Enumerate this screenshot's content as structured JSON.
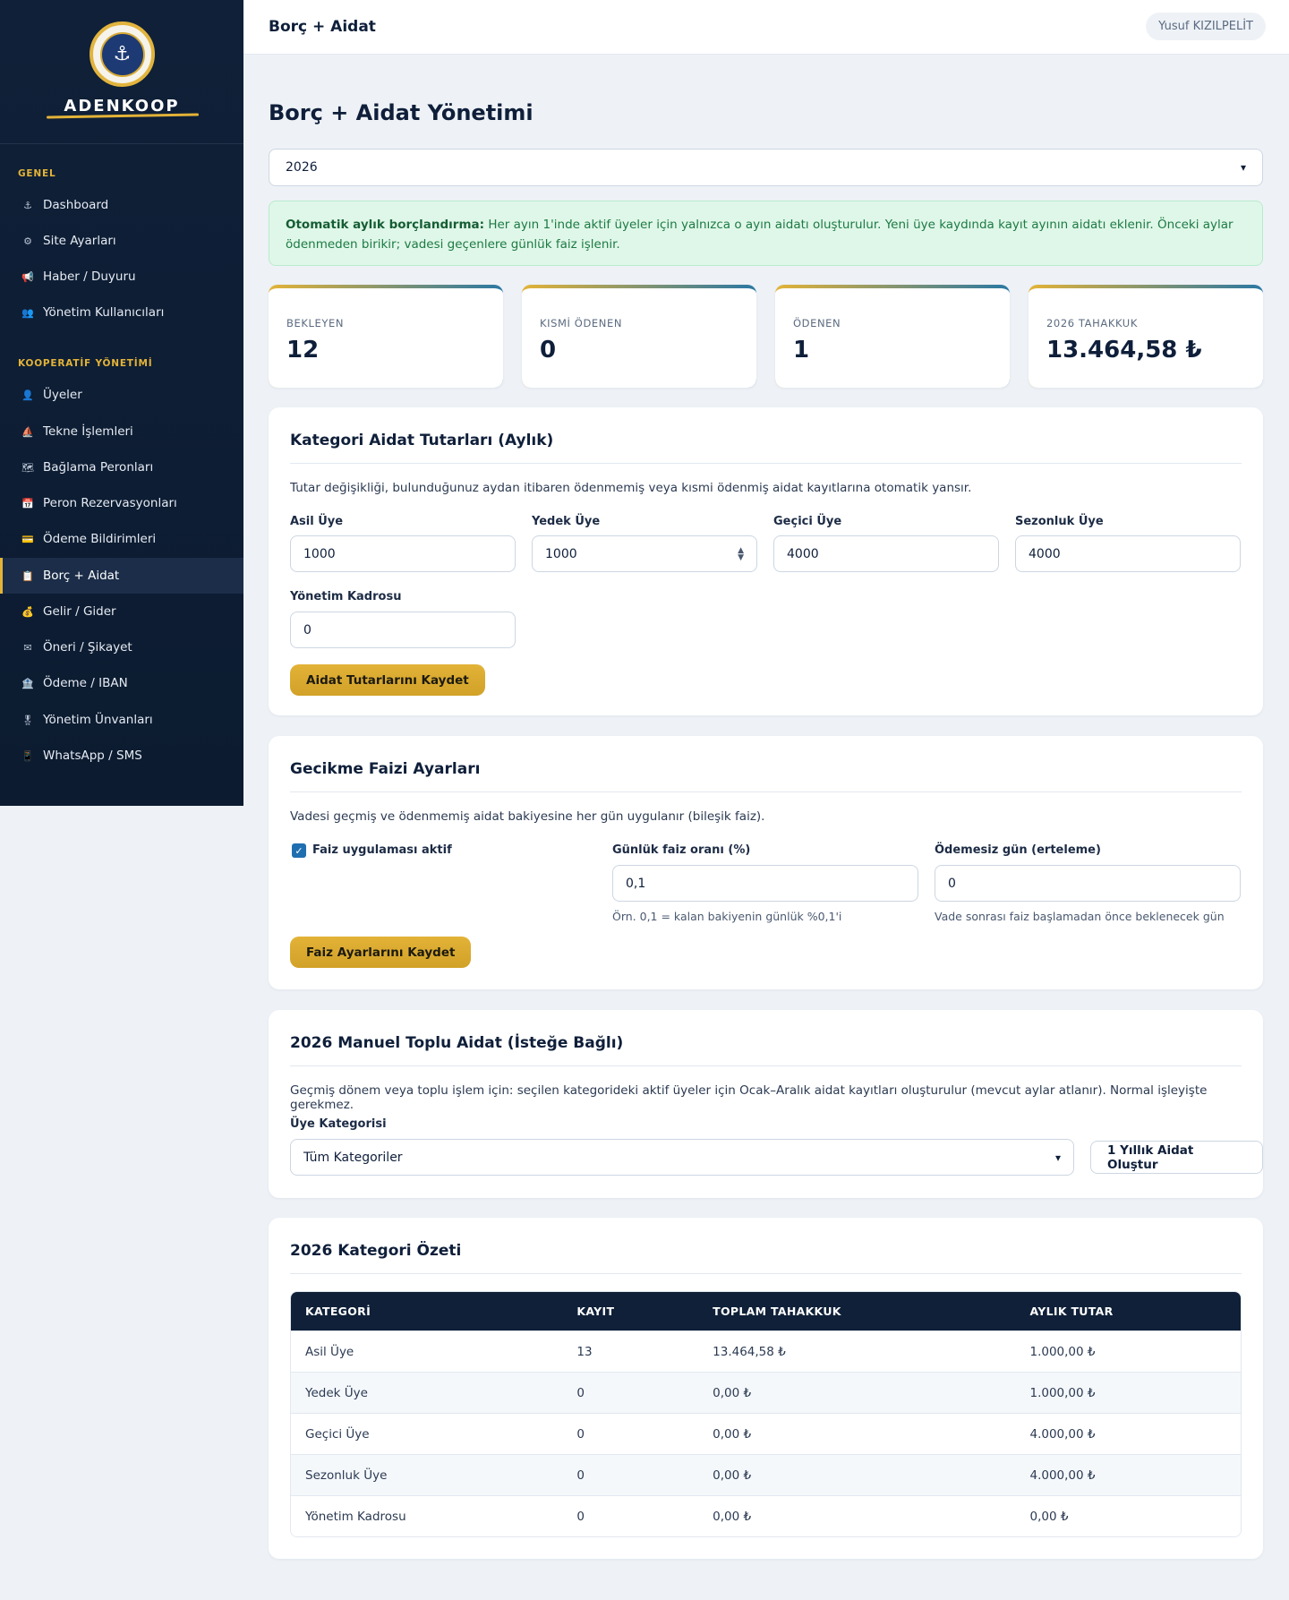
{
  "brand": {
    "name": "ADENKOOP"
  },
  "sidebar": {
    "groups": [
      {
        "title": "GENEL",
        "items": [
          {
            "label": "Dashboard",
            "icon": "⚓"
          },
          {
            "label": "Site Ayarları",
            "icon": "⚙"
          },
          {
            "label": "Haber / Duyuru",
            "icon": "📢"
          },
          {
            "label": "Yönetim Kullanıcıları",
            "icon": "👥"
          }
        ]
      },
      {
        "title": "KOOPERATİF YÖNETİMİ",
        "items": [
          {
            "label": "Üyeler",
            "icon": "👤"
          },
          {
            "label": "Tekne İşlemleri",
            "icon": "⛵"
          },
          {
            "label": "Bağlama Peronları",
            "icon": "🗺"
          },
          {
            "label": "Peron Rezervasyonları",
            "icon": "📅"
          },
          {
            "label": "Ödeme Bildirimleri",
            "icon": "💳"
          },
          {
            "label": "Borç + Aidat",
            "icon": "📋",
            "active": true
          },
          {
            "label": "Gelir / Gider",
            "icon": "💰"
          },
          {
            "label": "Öneri / Şikayet",
            "icon": "✉"
          },
          {
            "label": "Ödeme / IBAN",
            "icon": "🏦"
          },
          {
            "label": "Yönetim Ünvanları",
            "icon": "🎖"
          },
          {
            "label": "WhatsApp / SMS",
            "icon": "📱"
          }
        ]
      }
    ]
  },
  "topbar": {
    "title": "Borç + Aidat",
    "user": "Yusuf KIZILPELİT"
  },
  "page": {
    "title": "Borç + Aidat Yönetimi",
    "year_select": "2026",
    "notice": {
      "bold": "Otomatik aylık borçlandırma:",
      "text": " Her ayın 1'inde aktif üyeler için yalnızca o ayın aidatı oluşturulur. Yeni üye kaydında kayıt ayının aidatı eklenir. Önceki aylar ödenmeden birikir; vadesi geçenlere günlük faiz işlenir."
    }
  },
  "stats": [
    {
      "label": "BEKLEYEN",
      "value": "12"
    },
    {
      "label": "KISMİ ÖDENEN",
      "value": "0"
    },
    {
      "label": "ÖDENEN",
      "value": "1"
    },
    {
      "label": "2026 TAHAKKUK",
      "value": "13.464,58 ₺"
    }
  ],
  "category_fees": {
    "title": "Kategori Aidat Tutarları (Aylık)",
    "desc": "Tutar değişikliği, bulunduğunuz aydan itibaren ödenmemiş veya kısmi ödenmiş aidat kayıtlarına otomatik yansır.",
    "fields": [
      {
        "label": "Asil Üye",
        "value": "1000"
      },
      {
        "label": "Yedek Üye",
        "value": "1000"
      },
      {
        "label": "Geçici Üye",
        "value": "4000"
      },
      {
        "label": "Sezonluk Üye",
        "value": "4000"
      },
      {
        "label": "Yönetim Kadrosu",
        "value": "0"
      }
    ],
    "save_label": "Aidat Tutarlarını Kaydet"
  },
  "interest": {
    "title": "Gecikme Faizi Ayarları",
    "desc": "Vadesi geçmiş ve ödenmemiş aidat bakiyesine her gün uygulanır (bileşik faiz).",
    "checkbox_label": "Faiz uygulaması aktif",
    "checked": true,
    "rate_label": "Günlük faiz oranı (%)",
    "rate_value": "0,1",
    "rate_hint": "Örn. 0,1 = kalan bakiyenin günlük %0,1'i",
    "grace_label": "Ödemesiz gün (erteleme)",
    "grace_value": "0",
    "grace_hint": "Vade sonrası faiz başlamadan önce beklenecek gün",
    "save_label": "Faiz Ayarlarını Kaydet"
  },
  "bulk": {
    "title": "2026 Manuel Toplu Aidat (İsteğe Bağlı)",
    "desc": "Geçmiş dönem veya toplu işlem için: seçilen kategorideki aktif üyeler için Ocak–Aralık aidat kayıtları oluşturulur (mevcut aylar atlanır). Normal işleyişte gerekmez.",
    "category_label": "Üye Kategorisi",
    "category_value": "Tüm Kategoriler",
    "button_label": "1 Yıllık Aidat Oluştur"
  },
  "summary": {
    "title": "2026 Kategori Özeti",
    "headers": [
      "KATEGORİ",
      "KAYIT",
      "TOPLAM TAHAKKUK",
      "AYLIK TUTAR"
    ],
    "rows": [
      [
        "Asil Üye",
        "13",
        "13.464,58 ₺",
        "1.000,00 ₺"
      ],
      [
        "Yedek Üye",
        "0",
        "0,00 ₺",
        "1.000,00 ₺"
      ],
      [
        "Geçici Üye",
        "0",
        "0,00 ₺",
        "4.000,00 ₺"
      ],
      [
        "Sezonluk Üye",
        "0",
        "0,00 ₺",
        "4.000,00 ₺"
      ],
      [
        "Yönetim Kadrosu",
        "0",
        "0,00 ₺",
        "0,00 ₺"
      ]
    ]
  }
}
